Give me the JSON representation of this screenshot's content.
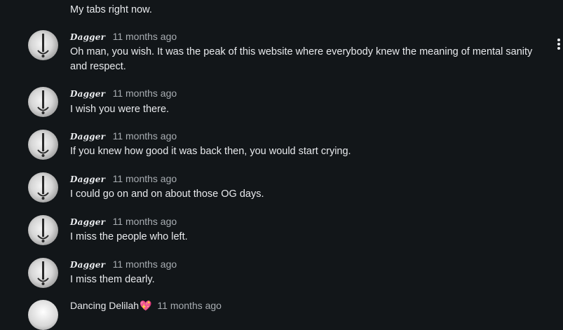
{
  "previous_comment": {
    "text": "My tabs right now."
  },
  "comments": [
    {
      "author": "Dagger",
      "time": "11 months ago",
      "text": "Oh man, you wish. It was the peak of this website where everybody knew the meaning of mental sanity and respect."
    },
    {
      "author": "Dagger",
      "time": "11 months ago",
      "text": "I wish you were there."
    },
    {
      "author": "Dagger",
      "time": "11 months ago",
      "text": "If you knew how good it was back then, you would start crying."
    },
    {
      "author": "Dagger",
      "time": "11 months ago",
      "text": "I could go on and on about those OG days."
    },
    {
      "author": "Dagger",
      "time": "11 months ago",
      "text": "I miss the people who left."
    },
    {
      "author": "Dagger",
      "time": "11 months ago",
      "text": "I miss them dearly."
    }
  ],
  "next_comment": {
    "author": "Dancing Delilah",
    "author_emoji": "💖",
    "time": "11 months ago"
  },
  "icons": {
    "more_options": "more-vertical-icon",
    "avatar": "dagger-avatar-icon"
  }
}
